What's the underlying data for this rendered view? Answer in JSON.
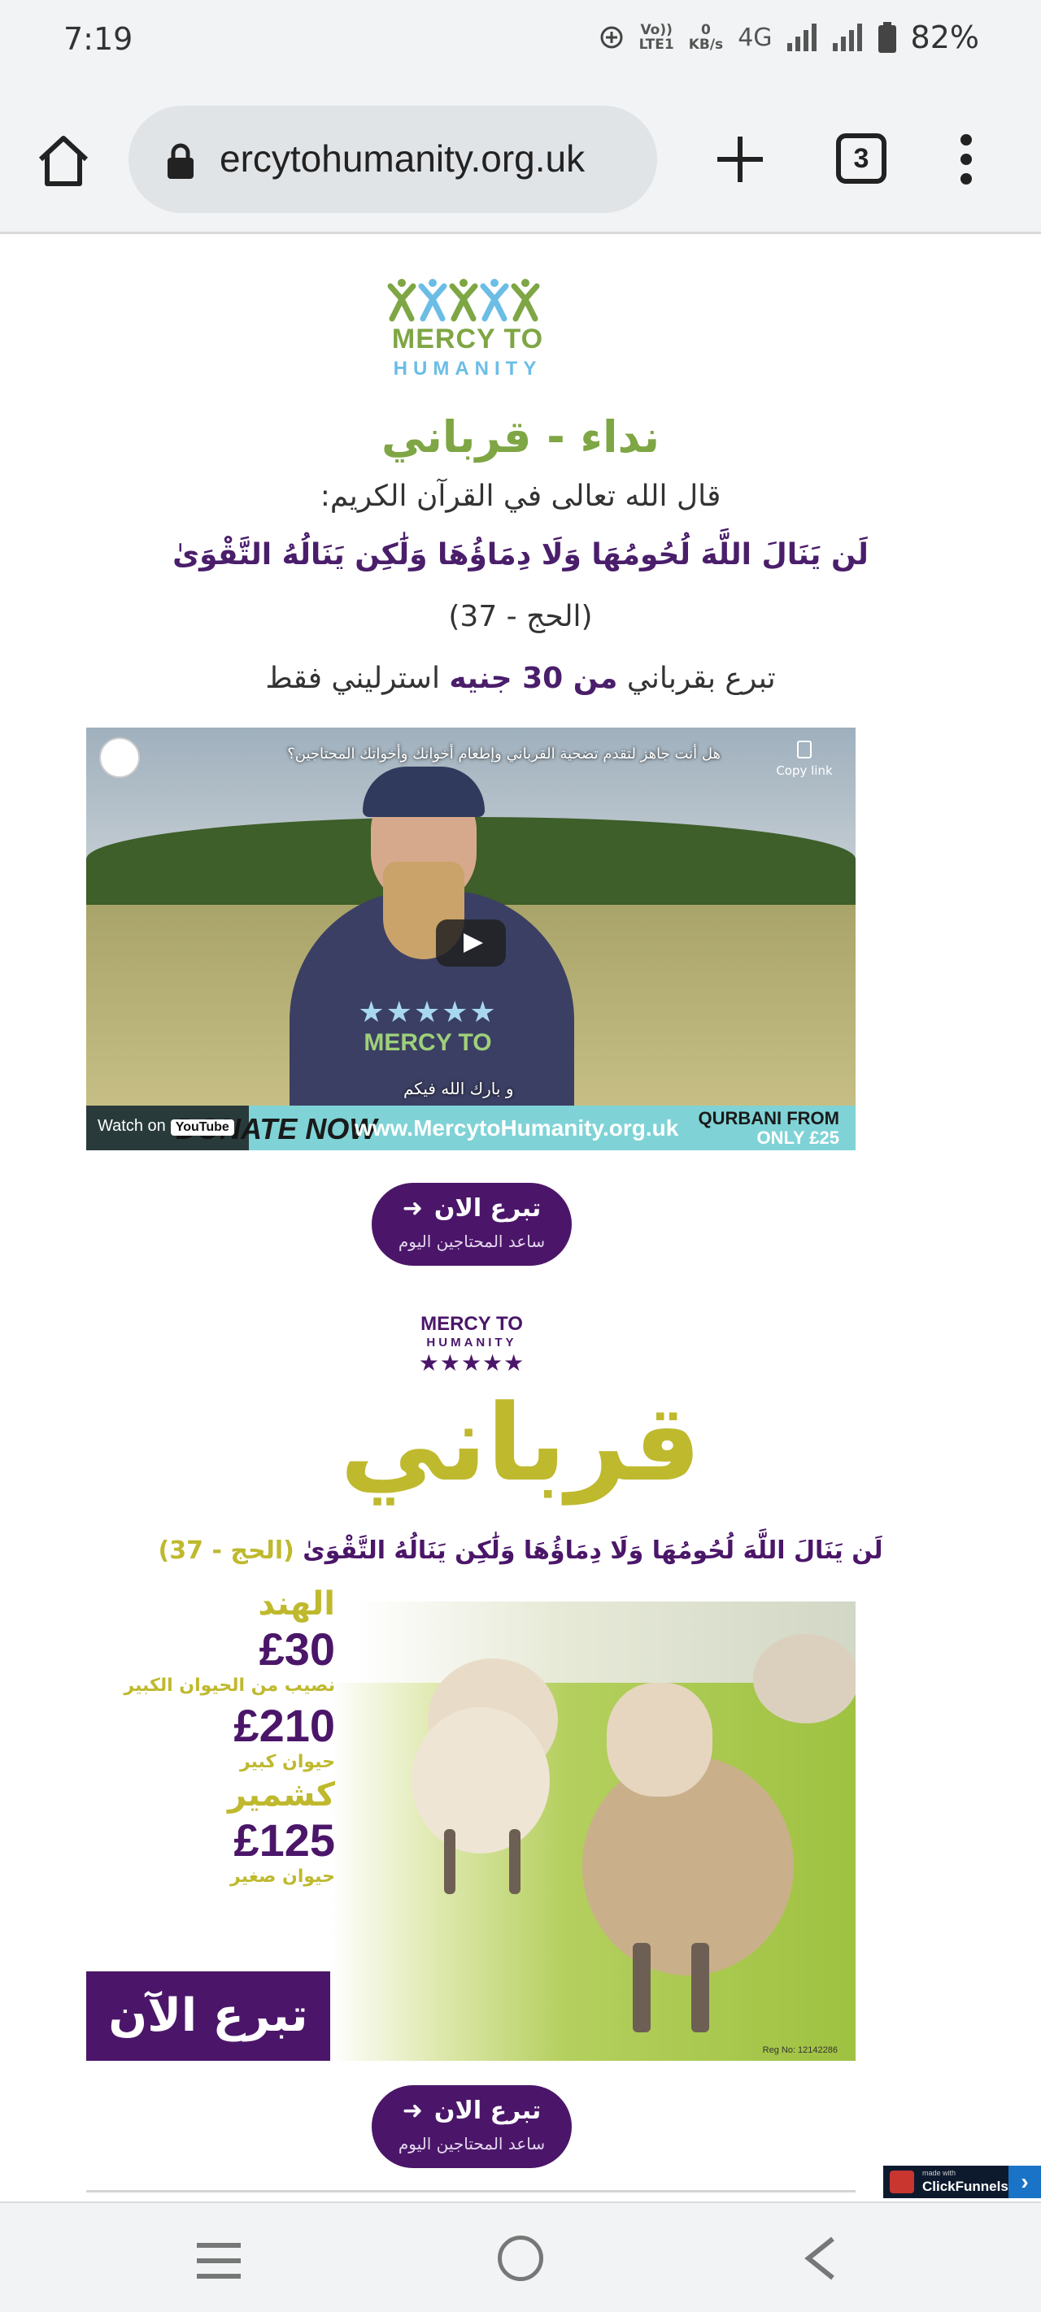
{
  "status_bar": {
    "time": "7:19",
    "volte": "Vo))",
    "lte": "LTE1",
    "data_speed_value": "0",
    "data_speed_unit": "KB/s",
    "network": "4G",
    "battery": "82%"
  },
  "browser": {
    "url": "ercytohumanity.org.uk",
    "tab_count": "3"
  },
  "page": {
    "logo": {
      "title": "MERCY TO",
      "subtitle": "HUMANITY"
    },
    "heading": "نداء - قرباني",
    "quran_intro": "قال الله تعالى في القرآن الكريم:",
    "ayah": "لَن يَنَالَ اللَّهَ لُحُومُهَا وَلَا دِمَاؤُهَا وَلَٰكِن يَنَالُهُ التَّقْوَىٰ",
    "ayah_reference": "(الحج - 37)",
    "donate_text_before": "تبرع بقرباني ",
    "donate_text_highlight": "من 30 جنيه",
    "donate_text_after": " استرليني فقط",
    "video": {
      "title": "هل أنت جاهز لتقدم تضحية القرباني وإطعام أخوانك وأخواتك المحتاجين؟",
      "copy_link": "Copy link",
      "caption": "و بارك الله فيكم",
      "banner_donate": "DONATE NOW",
      "banner_url": "www.MercytoHumanity.org.uk",
      "banner_qurbani": "QURBANI FROM",
      "banner_only": "ONLY £25",
      "watch_on": "Watch on",
      "youtube": "YouTube",
      "hoodie_title": "MERCY TO"
    },
    "donate_button": {
      "label": "تبرع الان",
      "sublabel": "ساعد المحتاجين اليوم"
    },
    "logo2": {
      "title": "MERCY TO",
      "subtitle": "HUMANITY"
    },
    "poster": {
      "headline": "قرباني",
      "ayah": "لَن يَنَالَ اللَّهَ لُحُومُهَا وَلَا دِمَاؤُهَا وَلَٰكِن يَنَالُهُ التَّقْوَىٰ",
      "ayah_reference": "(الحج - 37)",
      "prices": [
        {
          "country": "الهند",
          "amount": "£30",
          "desc": "نصيب من الحيوان الكبير"
        },
        {
          "country": "",
          "amount": "£210",
          "desc": "حيوان كبير"
        },
        {
          "country": "كشمير",
          "amount": "£125",
          "desc": "حيوان صغير"
        }
      ],
      "cta": "تبرع الآن",
      "reg_no": "Reg No: 12142286"
    },
    "donate_button_2": {
      "label": "تبرع الان",
      "sublabel": "ساعد المحتاجين اليوم"
    }
  },
  "badge": {
    "made_with": "made with",
    "name": "ClickFunnels"
  },
  "colors": {
    "brand_green": "#7ea644",
    "brand_purple": "#4b1669",
    "brand_olive": "#bfb92e",
    "brand_blue": "#6bbde6"
  }
}
